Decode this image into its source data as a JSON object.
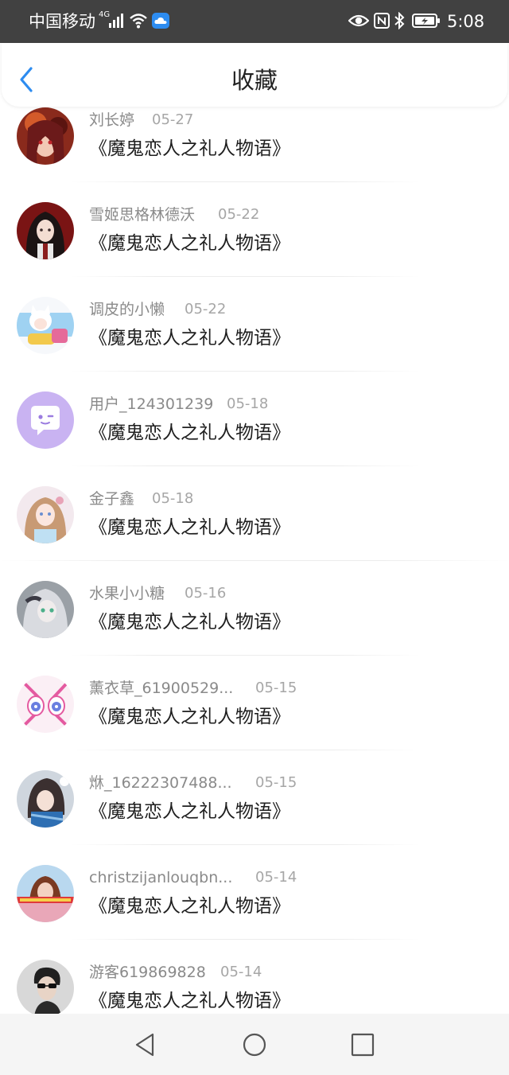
{
  "status_bar": {
    "carrier": "中国移动",
    "network": "4G",
    "time": "5:08"
  },
  "header": {
    "title": "收藏"
  },
  "items": [
    {
      "user": "刘长婷",
      "date": "05-27",
      "title": "《魔鬼恋人之礼人物语》"
    },
    {
      "user": "雪姬思格林德沃",
      "date": "05-22",
      "title": "《魔鬼恋人之礼人物语》"
    },
    {
      "user": "调皮的小懒",
      "date": "05-22",
      "title": "《魔鬼恋人之礼人物语》"
    },
    {
      "user": "用户_124301239",
      "date": "05-18",
      "title": "《魔鬼恋人之礼人物语》"
    },
    {
      "user": "金子鑫",
      "date": "05-18",
      "title": "《魔鬼恋人之礼人物语》"
    },
    {
      "user": "水果小小糖",
      "date": "05-16",
      "title": "《魔鬼恋人之礼人物语》"
    },
    {
      "user": "薰衣草_61900529...",
      "date": "05-15",
      "title": "《魔鬼恋人之礼人物语》"
    },
    {
      "user": "烌_16222307488...",
      "date": "05-15",
      "title": "《魔鬼恋人之礼人物语》"
    },
    {
      "user": "christzijanlouqbn...",
      "date": "05-14",
      "title": "《魔鬼恋人之礼人物语》"
    },
    {
      "user": "游客619869828",
      "date": "05-14",
      "title": "《魔鬼恋人之礼人物语》"
    }
  ],
  "colors": {
    "status_bar_bg": "#414141",
    "accent": "#2d8cf0",
    "default_avatar_bg": "#c9b3f2"
  },
  "icons": {
    "back": "chevron-left-icon",
    "nav_back": "triangle-back-icon",
    "nav_home": "circle-home-icon",
    "nav_recent": "square-recent-icon"
  }
}
